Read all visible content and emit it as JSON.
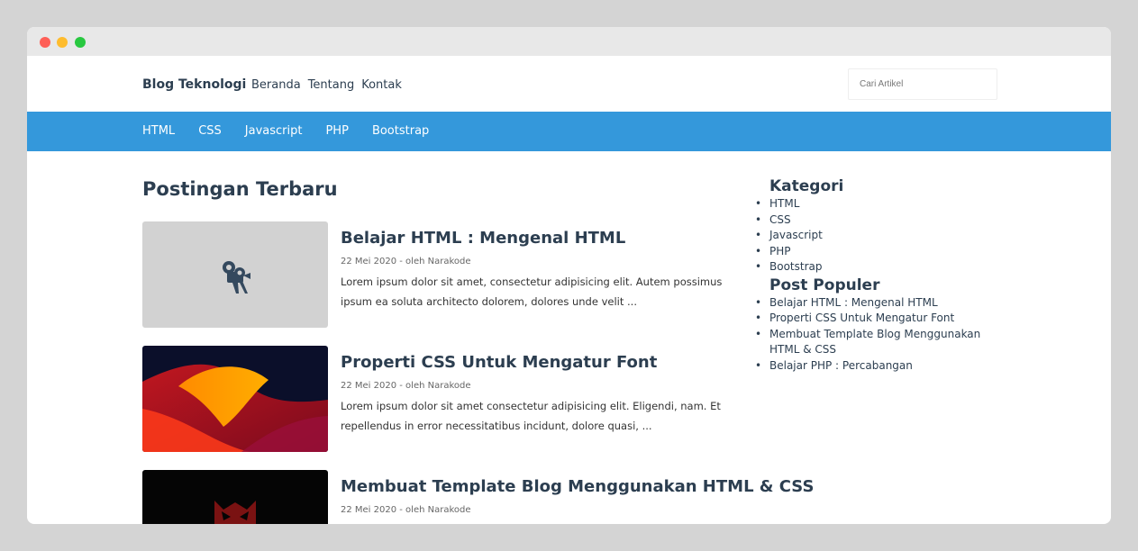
{
  "navbar": {
    "brand": "Blog Teknologi",
    "links": [
      "Beranda",
      "Tentang",
      "Kontak"
    ],
    "search_placeholder": "Cari Artikel"
  },
  "categories_bar": [
    "HTML",
    "CSS",
    "Javascript",
    "PHP",
    "Bootstrap"
  ],
  "main": {
    "section_title": "Postingan Terbaru",
    "posts": [
      {
        "title": "Belajar HTML : Mengenal HTML",
        "meta": "22 Mei 2020 - oleh Narakode",
        "excerpt": "Lorem ipsum dolor sit amet, consectetur adipisicing elit. Autem possimus ipsum ea soluta architecto dolorem, dolores unde velit ..."
      },
      {
        "title": "Properti CSS Untuk Mengatur Font",
        "meta": "22 Mei 2020 - oleh Narakode",
        "excerpt": "Lorem ipsum dolor sit amet consectetur adipisicing elit. Eligendi, nam. Et repellendus in error necessitatibus incidunt, dolore quasi, ..."
      },
      {
        "title": "Membuat Template Blog Menggunakan HTML & CSS",
        "meta": "22 Mei 2020 - oleh Narakode",
        "excerpt": ""
      }
    ]
  },
  "sidebar": {
    "kategori_title": "Kategori",
    "kategori": [
      "HTML",
      "CSS",
      "Javascript",
      "PHP",
      "Bootstrap"
    ],
    "populer_title": "Post Populer",
    "populer": [
      "Belajar HTML : Mengenal HTML",
      "Properti CSS Untuk Mengatur Font",
      "Membuat Template Blog Menggunakan HTML & CSS",
      "Belajar PHP : Percabangan"
    ]
  },
  "colors": {
    "accent": "#3498db",
    "text": "#2c3e50"
  }
}
